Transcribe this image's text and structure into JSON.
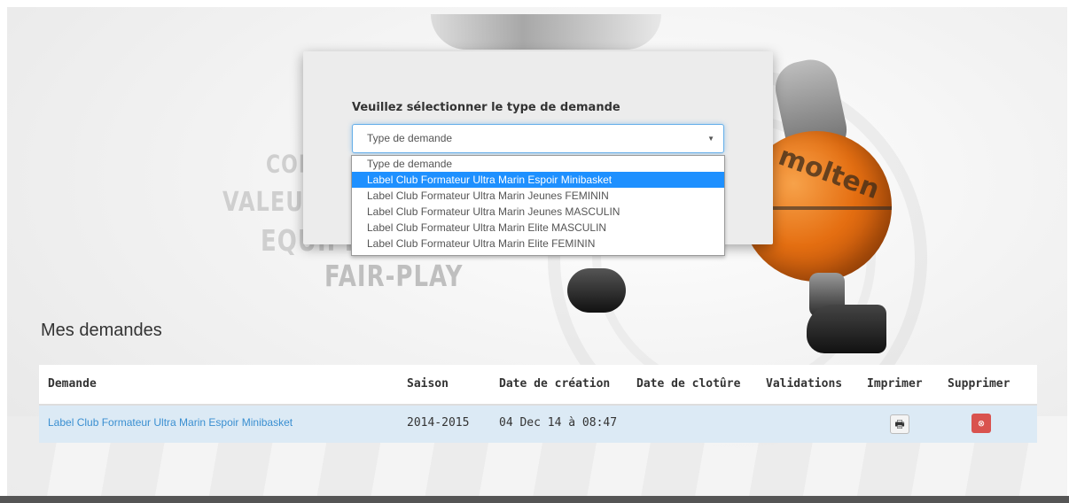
{
  "modal": {
    "title": "Veuillez sélectionner le type de demande",
    "select_value": "Type de demande",
    "options": [
      "Type de demande",
      "Label Club Formateur Ultra Marin Espoir Minibasket",
      "Label Club Formateur Ultra Marin Jeunes FEMININ",
      "Label Club Formateur Ultra Marin Jeunes MASCULIN",
      "Label Club Formateur Ultra Marin Elite MASCULIN",
      "Label Club Formateur Ultra Marin Elite FEMININ"
    ],
    "selected_option": "Label Club Formateur Ultra Marin Espoir Minibasket"
  },
  "background": {
    "slogans": [
      "COM",
      "VALEURS",
      "EQUIPE",
      "FAIR-PLAY"
    ],
    "ball_brand": "molten"
  },
  "section": {
    "title": "Mes demandes"
  },
  "table": {
    "headers": [
      "Demande",
      "Saison",
      "Date de création",
      "Date de clotûre",
      "Validations",
      "Imprimer",
      "Supprimer"
    ],
    "rows": [
      {
        "demande": "Label Club Formateur Ultra Marin Espoir Minibasket",
        "saison": "2014-2015",
        "date_creation": "04 Dec 14 à 08:47",
        "date_cloture": "",
        "validations": ""
      }
    ]
  },
  "icons": {
    "print": "printer-icon",
    "delete": "delete-icon",
    "caret": "caret-down-icon"
  },
  "colors": {
    "link": "#3a8fd1",
    "row_bg": "#dceaf5",
    "delete": "#d9534f",
    "selected": "#1e90ff"
  }
}
